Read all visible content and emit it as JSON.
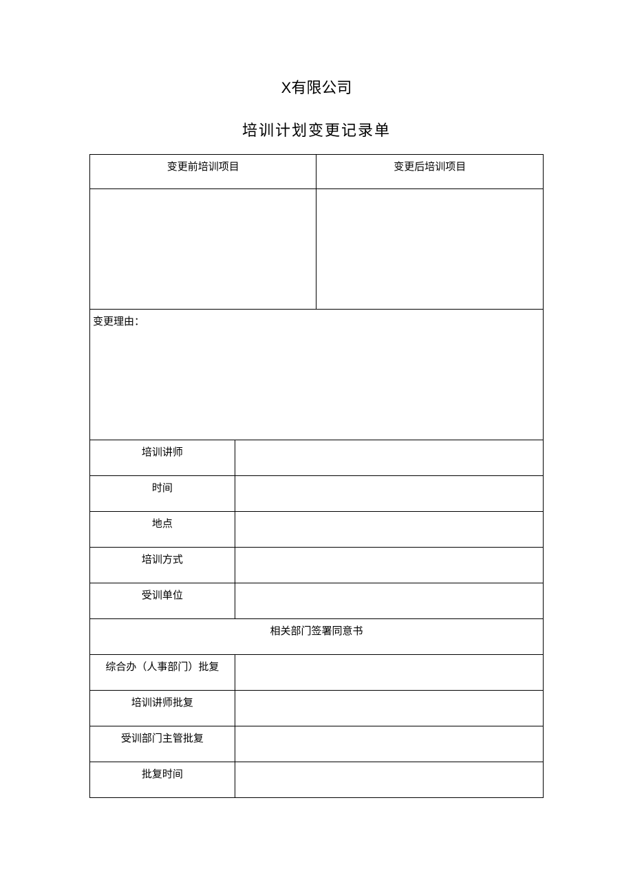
{
  "company": "X有限公司",
  "formTitle": "培训计划变更记录单",
  "headers": {
    "before": "变更前培训项目",
    "after": "变更后培训项目"
  },
  "reasonLabel": "变更理由：",
  "fields": {
    "instructor": "培训讲师",
    "time": "时间",
    "location": "地点",
    "method": "培训方式",
    "trainee": "受训单位"
  },
  "sectionHeader": "相关部门签署同意书",
  "approvals": {
    "hr": "综合办（人事部门）批复",
    "instructor": "培训讲师批复",
    "supervisor": "受训部门主管批复",
    "time": "批复时间"
  },
  "values": {
    "beforeContent": "",
    "afterContent": "",
    "reasonContent": "",
    "instructorValue": "",
    "timeValue": "",
    "locationValue": "",
    "methodValue": "",
    "traineeValue": "",
    "hrValue": "",
    "instructorApprovalValue": "",
    "supervisorValue": "",
    "approvalTimeValue": ""
  }
}
